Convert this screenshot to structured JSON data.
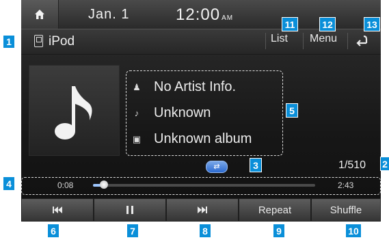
{
  "status_bar": {
    "date": "Jan.  1",
    "time": "12:00",
    "ampm": "AM"
  },
  "header": {
    "source_label": "iPod",
    "list_label": "List",
    "menu_label": "Menu"
  },
  "track_info": {
    "artist": "No Artist Info.",
    "title": "Unknown",
    "album": "Unknown album"
  },
  "playback": {
    "track_count": "1/510",
    "elapsed": "0:08",
    "total": "2:43",
    "progress_fraction": 0.05,
    "repeat_badge_text": "⇄"
  },
  "controls": {
    "repeat_label": "Repeat",
    "shuffle_label": "Shuffle"
  },
  "callouts": [
    "1",
    "2",
    "3",
    "4",
    "5",
    "6",
    "7",
    "8",
    "9",
    "10",
    "11",
    "12",
    "13"
  ],
  "colors": {
    "callout_blue": "#0a8fd9",
    "progress_fill": "#9ec7ff",
    "repeat_badge": "#2c6ad0"
  }
}
